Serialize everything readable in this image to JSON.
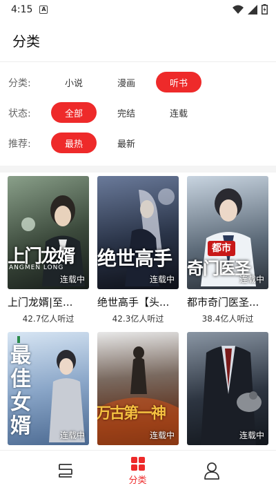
{
  "status_bar": {
    "time": "4:15"
  },
  "header": {
    "title": "分类"
  },
  "filters": [
    {
      "label": "分类:",
      "options": [
        "小说",
        "漫画",
        "听书"
      ],
      "selected": 2
    },
    {
      "label": "状态:",
      "options": [
        "全部",
        "完结",
        "连载"
      ],
      "selected": 0
    },
    {
      "label": "推荐:",
      "options": [
        "最热",
        "最新"
      ],
      "selected": 0
    }
  ],
  "books": [
    {
      "title": "上门龙婿|至...",
      "count": "42.7亿人听过",
      "status": "连载中",
      "cover_text": "上门龙婿",
      "cover_sub": "ANGMEN LONG",
      "theme": "#3c4a3c"
    },
    {
      "title": "绝世高手【头...",
      "count": "42.3亿人听过",
      "status": "连载中",
      "cover_text": "绝世高手",
      "theme": "#2a3448"
    },
    {
      "title": "都市奇门医圣...",
      "count": "38.4亿人听过",
      "status": "连载中",
      "cover_text": "奇门医圣",
      "badge": "都市",
      "theme": "#5c6a78"
    },
    {
      "title": "",
      "count": "",
      "status": "连载中",
      "cover_text": "最佳女婿",
      "theme": "#6a8ab0"
    },
    {
      "title": "",
      "count": "",
      "status": "连载中",
      "cover_text": "万古第一神",
      "theme": "#5a2a14"
    },
    {
      "title": "",
      "count": "",
      "status": "连载中",
      "cover_text": "",
      "theme": "#2c3440"
    }
  ],
  "tabbar": {
    "items": [
      {
        "label": ""
      },
      {
        "label": "分类"
      },
      {
        "label": ""
      }
    ],
    "active": 1
  },
  "colors": {
    "accent": "#ee2a2a"
  }
}
